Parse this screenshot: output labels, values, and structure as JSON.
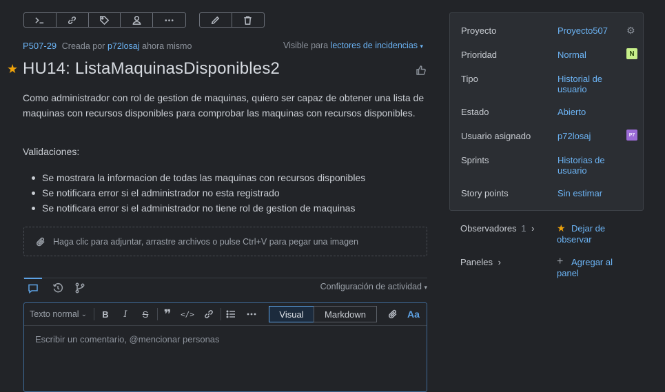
{
  "toolbar": {
    "icons": [
      "terminal-icon",
      "link-icon",
      "tag-icon",
      "assign-user-icon",
      "more-icon",
      "edit-icon",
      "trash-icon"
    ]
  },
  "issue": {
    "key": "P507-29",
    "created_by_prefix": "Creada por",
    "author": "p72losaj",
    "created_time": "ahora mismo",
    "visibility_prefix": "Visible para",
    "visibility": "lectores de incidencias",
    "title": "HU14: ListaMaquinasDisponibles2",
    "description": "Como administrador con rol de gestion de maquinas, quiero ser capaz de obtener una lista de maquinas con recursos disponibles para comprobar las maquinas con recursos disponibles.",
    "validations_heading": "Validaciones:",
    "validations": [
      "Se mostrara la informacion de todas las maquinas con recursos disponibles",
      "Se notificara error si el administrador no esta registrado",
      "Se notificara error si el administrador no tiene rol de gestion de maquinas"
    ],
    "attach_hint": "Haga clic para adjuntar, arrastre archivos o pulse Ctrl+V para pegar una imagen"
  },
  "activity": {
    "settings_label": "Configuración de actividad"
  },
  "editor": {
    "text_style": "Texto normal",
    "mode_visual": "Visual",
    "mode_markdown": "Markdown",
    "font_toggle": "Aa",
    "placeholder": "Escribir un comentario, @mencionar personas"
  },
  "details": {
    "rows": [
      {
        "label": "Proyecto",
        "value": "Proyecto507"
      },
      {
        "label": "Prioridad",
        "value": "Normal",
        "badge": "N"
      },
      {
        "label": "Tipo",
        "value": "Historial de usuario"
      },
      {
        "label": "Estado",
        "value": "Abierto"
      },
      {
        "label": "Usuario asignado",
        "value": "p72losaj",
        "badge": "P7"
      },
      {
        "label": "Sprints",
        "value": "Historias de usuario"
      },
      {
        "label": "Story points",
        "value": "Sin estimar"
      }
    ]
  },
  "watchers": {
    "label": "Observadores",
    "count": "1",
    "action": "Dejar de observar"
  },
  "boards": {
    "label": "Paneles",
    "action": "Agregar al panel"
  },
  "colors": {
    "accent": "#6cb4f5",
    "background": "#222428",
    "panel": "#2b2e33",
    "star": "#f0a30a",
    "priority_badge": "#c7f08a",
    "avatar_badge": "#9b6bd6"
  }
}
